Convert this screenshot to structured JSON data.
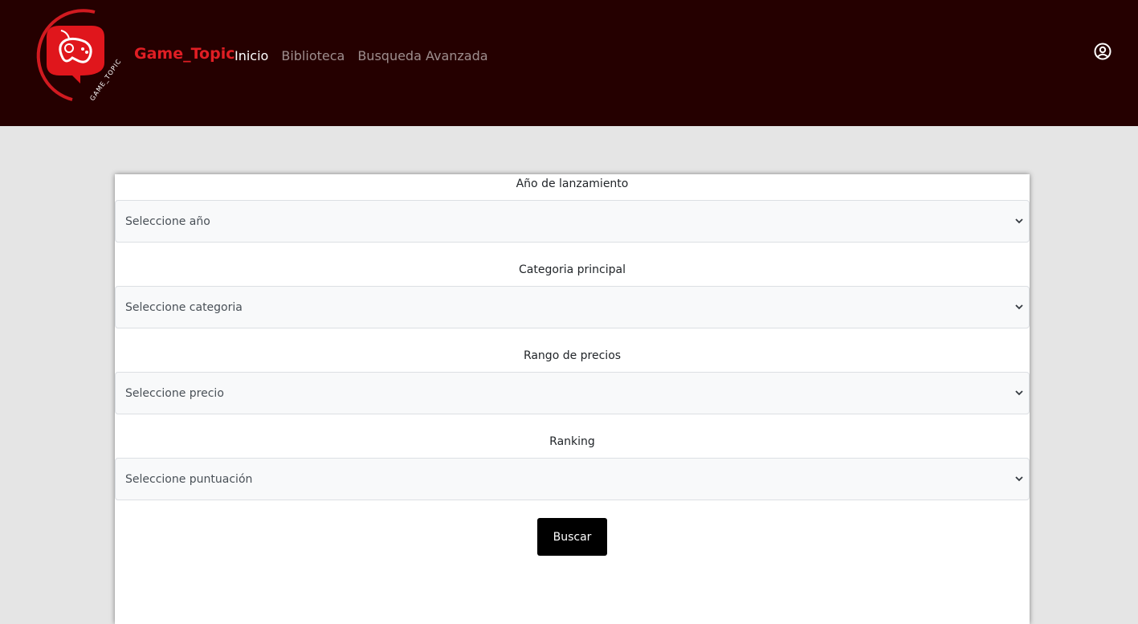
{
  "header": {
    "brand": "Game_Topic",
    "logo_text": "GAME_TOPIC",
    "nav": [
      {
        "label": "Inicio",
        "active": true
      },
      {
        "label": "Biblioteca",
        "active": false
      },
      {
        "label": "Busqueda Avanzada",
        "active": false
      }
    ]
  },
  "form": {
    "fields": [
      {
        "label": "Año de lanzamiento",
        "placeholder": "Seleccione año"
      },
      {
        "label": "Categoria principal",
        "placeholder": "Seleccione categoria"
      },
      {
        "label": "Rango de precios",
        "placeholder": "Seleccione precio"
      },
      {
        "label": "Ranking",
        "placeholder": "Seleccione puntuación"
      }
    ],
    "submit_label": "Buscar"
  },
  "colors": {
    "header_bg": "#250000",
    "brand": "#e01e24",
    "page_bg": "#e5e5e5",
    "button_bg": "#000000"
  },
  "icons": {
    "logo": "gamepad-chat-logo-icon",
    "user": "user-circle-icon",
    "dropdown": "chevron-down-icon"
  }
}
